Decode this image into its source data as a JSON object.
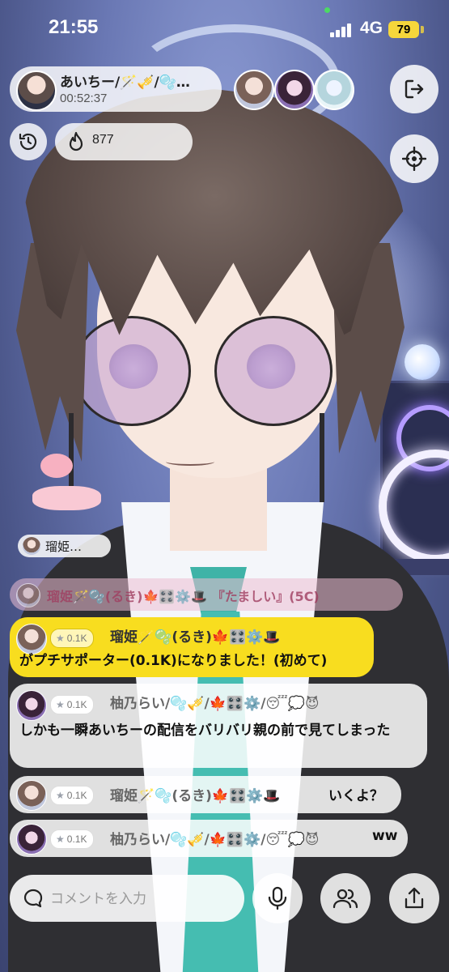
{
  "status_bar": {
    "time": "21:55",
    "network": "4G",
    "battery": "79"
  },
  "host": {
    "name": "あいちー/🪄🎺/🫧…",
    "duration": "00:52:37"
  },
  "points": {
    "value": "877"
  },
  "icons": {
    "exit": "exit-icon",
    "target": "crosshair-icon",
    "history": "history-icon",
    "flame": "flame-icon",
    "mic": "mic-icon",
    "people": "people-icon",
    "share": "share-icon",
    "chat": "chat-bubble-icon"
  },
  "mini_tag": {
    "label": "瑠姫…"
  },
  "chat": {
    "faded": {
      "text": "瑠姫🪄🫧(るき)🍁🎛️⚙️🎩 『たましい』(5C)"
    },
    "gift": {
      "level": "0.1K",
      "user": "瑠姫🪄🫧(るき)🍁🎛️⚙️🎩",
      "text": "がプチサポーター(0.1K)になりました！(初めて)"
    },
    "messages": [
      {
        "level": "0.1K",
        "user": "柚乃らい/🫧🎺/🍁🎛️⚙️/😴💭😈",
        "text": "しかも一瞬あいちーの配信をバリバリ親の前で見てしまった"
      },
      {
        "level": "0.1K",
        "user": "瑠姫🪄🫧(るき)🍁🎛️⚙️🎩",
        "text": "いくよ？"
      },
      {
        "level": "0.1K",
        "user": "柚乃らい/🫧🎺/🍁🎛️⚙️/😴💭😈",
        "text": "ww"
      }
    ]
  },
  "comment_input": {
    "placeholder": "コメントを入力"
  },
  "colors": {
    "gift_bg": "#f8dd1f",
    "battery": "#f5d63b",
    "tie": "#45bdb1"
  }
}
